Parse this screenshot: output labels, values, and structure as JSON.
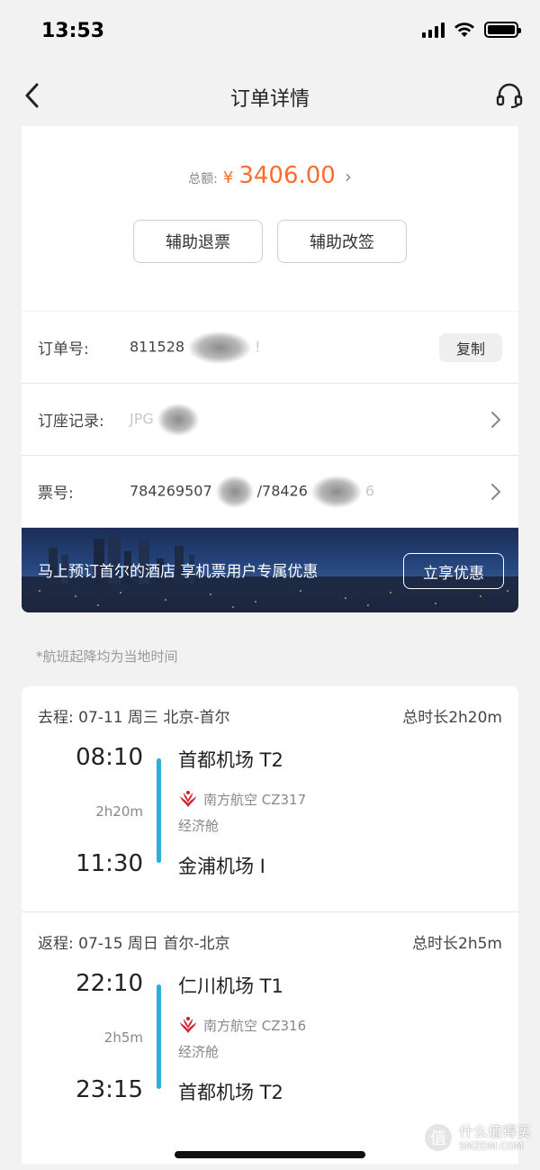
{
  "status_bar": {
    "time": "13:53"
  },
  "nav": {
    "title": "订单详情"
  },
  "summary": {
    "total_label": "总额:",
    "currency": "¥",
    "amount": "3406.00",
    "buttons": [
      "辅助退票",
      "辅助改签"
    ]
  },
  "info": {
    "order_no_label": "订单号:",
    "order_no_value": "811528",
    "order_no_tail": "!",
    "copy_label": "复制",
    "booking_label": "订座记录:",
    "booking_value": "JPG",
    "ticket_label": "票号:",
    "ticket_value_a": "784269507",
    "ticket_value_b": "/78426",
    "ticket_value_c": "6"
  },
  "banner": {
    "text": "马上预订首尔的酒店 享机票用户专属优惠",
    "button": "立享优惠"
  },
  "note": "*航班起降均为当地时间",
  "legs": [
    {
      "header": "去程: 07-11 周三 北京-首尔",
      "total_duration": "总时长2h20m",
      "dep_time": "08:10",
      "dep_airport": "首都机场 T2",
      "duration": "2h20m",
      "airline": "南方航空 CZ317",
      "cabin": "经济舱",
      "arr_time": "11:30",
      "arr_airport": "金浦机场 I"
    },
    {
      "header": "返程: 07-15 周日 首尔-北京",
      "total_duration": "总时长2h5m",
      "dep_time": "22:10",
      "dep_airport": "仁川机场 T1",
      "duration": "2h5m",
      "airline": "南方航空 CZ316",
      "cabin": "经济舱",
      "arr_time": "23:15",
      "arr_airport": "首都机场 T2"
    }
  ],
  "watermark": {
    "mark": "值",
    "text": "什么值得买",
    "sub": "SMZDM.COM"
  },
  "colors": {
    "accent": "#ff6b2c",
    "timeline": "#2bb0db",
    "airline_red": "#d81e2c"
  }
}
